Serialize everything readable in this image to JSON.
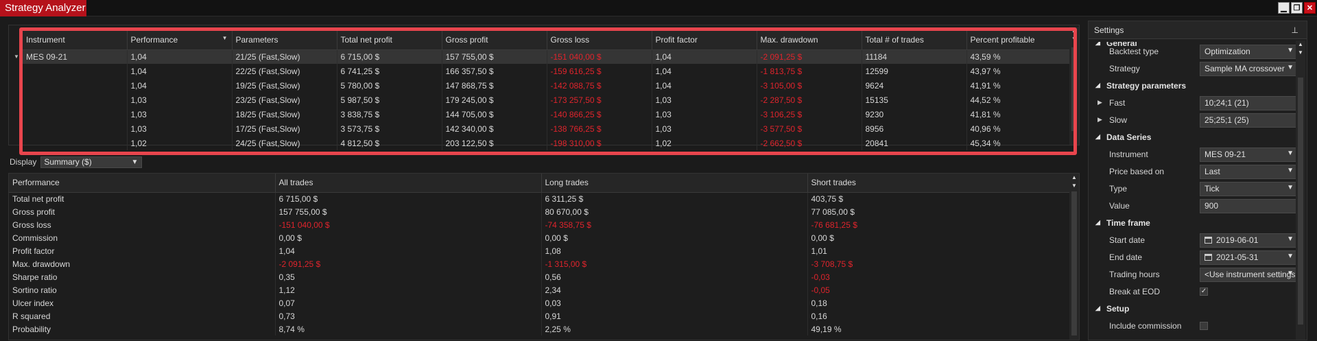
{
  "window": {
    "title": "Strategy Analyzer",
    "btn_min": "▁",
    "btn_restore": "❐",
    "btn_close": "✕"
  },
  "optimization": {
    "columns": [
      "Instrument",
      "Performance",
      "Parameters",
      "Total net profit",
      "Gross profit",
      "Gross loss",
      "Profit factor",
      "Max. drawdown",
      "Total # of trades",
      "Percent profitable"
    ],
    "rows": [
      [
        "MES 09-21",
        "1,04",
        "21/25 (Fast,Slow)",
        "6 715,00 $",
        "157 755,00 $",
        "-151 040,00 $",
        "1,04",
        "-2 091,25 $",
        "11184",
        "43,59 %"
      ],
      [
        "",
        "1,04",
        "22/25 (Fast,Slow)",
        "6 741,25 $",
        "166 357,50 $",
        "-159 616,25 $",
        "1,04",
        "-1 813,75 $",
        "12599",
        "43,97 %"
      ],
      [
        "",
        "1,04",
        "19/25 (Fast,Slow)",
        "5 780,00 $",
        "147 868,75 $",
        "-142 088,75 $",
        "1,04",
        "-3 105,00 $",
        "9624",
        "41,91 %"
      ],
      [
        "",
        "1,03",
        "23/25 (Fast,Slow)",
        "5 987,50 $",
        "179 245,00 $",
        "-173 257,50 $",
        "1,03",
        "-2 287,50 $",
        "15135",
        "44,52 %"
      ],
      [
        "",
        "1,03",
        "18/25 (Fast,Slow)",
        "3 838,75 $",
        "144 705,00 $",
        "-140 866,25 $",
        "1,03",
        "-3 106,25 $",
        "9230",
        "41,81 %"
      ],
      [
        "",
        "1,03",
        "17/25 (Fast,Slow)",
        "3 573,75 $",
        "142 340,00 $",
        "-138 766,25 $",
        "1,03",
        "-3 577,50 $",
        "8956",
        "40,96 %"
      ],
      [
        "",
        "1,02",
        "24/25 (Fast,Slow)",
        "4 812,50 $",
        "203 122,50 $",
        "-198 310,00 $",
        "1,02",
        "-2 662,50 $",
        "20841",
        "45,34 %"
      ]
    ]
  },
  "display": {
    "label": "Display",
    "value": "Summary ($)"
  },
  "summary": {
    "columns": [
      "Performance",
      "All trades",
      "Long trades",
      "Short trades"
    ],
    "rows": [
      [
        "Total net profit",
        "6 715,00 $",
        "6 311,25 $",
        "403,75 $"
      ],
      [
        "Gross profit",
        "157 755,00 $",
        "80 670,00 $",
        "77 085,00 $"
      ],
      [
        "Gross loss",
        "-151 040,00 $",
        "-74 358,75 $",
        "-76 681,25 $"
      ],
      [
        "Commission",
        "0,00 $",
        "0,00 $",
        "0,00 $"
      ],
      [
        "Profit factor",
        "1,04",
        "1,08",
        "1,01"
      ],
      [
        "Max. drawdown",
        "-2 091,25 $",
        "-1 315,00 $",
        "-3 708,75 $"
      ],
      [
        "Sharpe ratio",
        "0,35",
        "0,56",
        "-0,03"
      ],
      [
        "Sortino ratio",
        "1,12",
        "2,34",
        "-0,05"
      ],
      [
        "Ulcer index",
        "0,07",
        "0,03",
        "0,18"
      ],
      [
        "R squared",
        "0,73",
        "0,91",
        "0,16"
      ],
      [
        "Probability",
        "8,74 %",
        "2,25 %",
        "49,19 %"
      ]
    ]
  },
  "settings": {
    "title": "Settings",
    "general": "General",
    "backtest_type_label": "Backtest type",
    "backtest_type": "Optimization",
    "strategy_label": "Strategy",
    "strategy": "Sample MA crossover",
    "strategy_params": "Strategy parameters",
    "fast_label": "Fast",
    "fast": "10;24;1 (21)",
    "slow_label": "Slow",
    "slow": "25;25;1 (25)",
    "data_series": "Data Series",
    "instrument_label": "Instrument",
    "instrument": "MES 09-21",
    "price_based_label": "Price based on",
    "price_based": "Last",
    "type_label": "Type",
    "type": "Tick",
    "value_label": "Value",
    "value": "900",
    "time_frame": "Time frame",
    "start_label": "Start date",
    "start": "2019-06-01",
    "end_label": "End date",
    "end": "2021-05-31",
    "hours_label": "Trading hours",
    "hours": "<Use instrument settings>",
    "eod_label": "Break at EOD",
    "setup": "Setup",
    "commission_label": "Include commission"
  }
}
